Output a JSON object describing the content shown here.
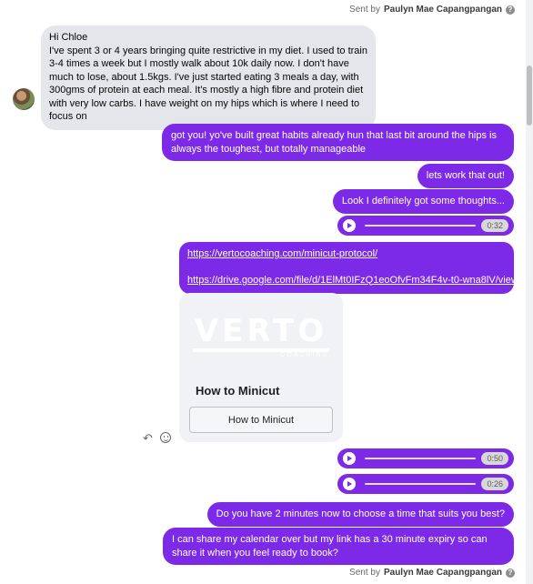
{
  "sent_by_top": {
    "prefix": "Sent by",
    "name": "Paulyn Mae Capangpangan"
  },
  "incoming": {
    "text": "Hi Chloe\nI've spent 3 or 4 years bringing quite restrictive in my diet. I used to train 3-4 times a week but I mostly walk about 10k daily now. I don't have much to lose, about 1.5kgs. I've just started eating 3 meals a day, with 300gms of protein at each meal. It's mostly a high fibre and protein diet with very low carbs. I have weight on my hips which is where I need to focus on"
  },
  "outgoing": {
    "msg1": "got you! yo've built great habits already hun that last bit around the hips is always the toughest, but totally manageable",
    "msg2": "lets work that out!",
    "msg3": "Look I definitely got some thoughts...",
    "audio1": "0:32",
    "link1": "https://vertocoaching.com/minicut-protocol/",
    "link2": "https://drive.google.com/file/d/1ElMt0IFzQ1eoOfvFm34F4v-t0-wna8lV/view",
    "audio2": "0:50",
    "audio3": "0:26",
    "msg4": "Do you have 2 minutes now to choose a time that suits you best?",
    "msg5": "I can share my calendar over but my link has a 30 minute expiry so can share it when you feel ready to book?"
  },
  "card": {
    "logo": "VERTO",
    "logo_sub": "COACHING",
    "title": "How to Minicut",
    "button": "How to Minicut"
  },
  "sent_by_bottom": {
    "prefix": "Sent by",
    "name": "Paulyn Mae Capangpangan"
  },
  "colors": {
    "outgoing_bubble": "#7c2ae8",
    "incoming_bubble": "#e4e6eb"
  }
}
